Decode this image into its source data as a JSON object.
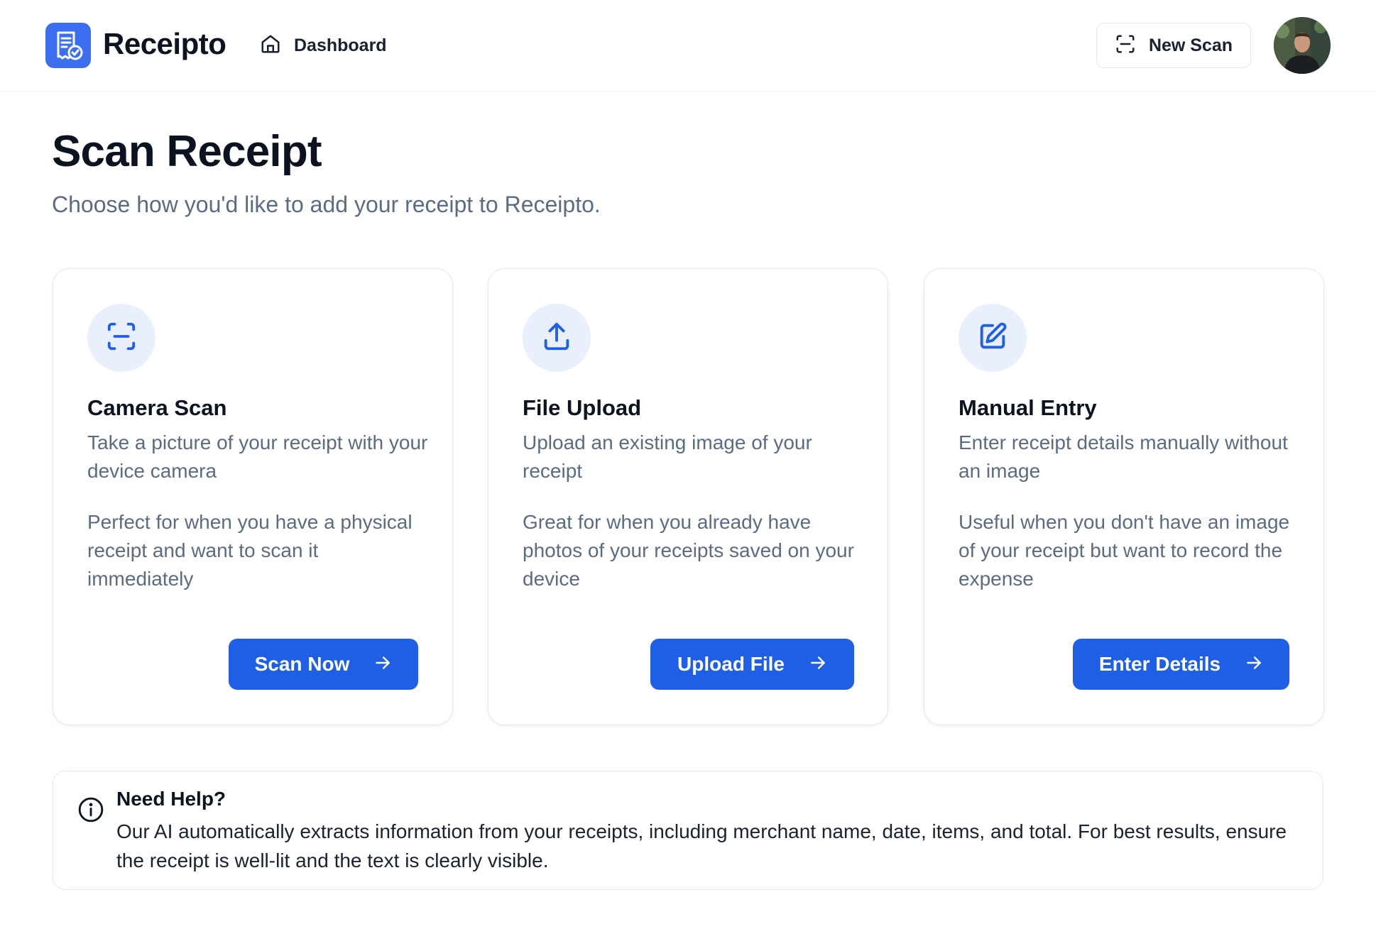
{
  "app": {
    "name": "Receipto"
  },
  "header": {
    "nav": [
      {
        "label": "Dashboard",
        "icon": "home-icon"
      }
    ],
    "new_scan_label": "New Scan",
    "new_scan_icon": "scan-frame-icon",
    "avatar": "user-avatar"
  },
  "page": {
    "title": "Scan Receipt",
    "subtitle": "Choose how you'd like to add your receipt to Receipto."
  },
  "cards": [
    {
      "icon": "scan-frame-icon",
      "title": "Camera Scan",
      "description": "Take a picture of your receipt with your device camera",
      "detail": "Perfect for when you have a physical receipt and want to scan it immediately",
      "action_label": "Scan Now"
    },
    {
      "icon": "upload-icon",
      "title": "File Upload",
      "description": "Upload an existing image of your receipt",
      "detail": "Great for when you already have photos of your receipts saved on your device",
      "action_label": "Upload File"
    },
    {
      "icon": "edit-icon",
      "title": "Manual Entry",
      "description": "Enter receipt details manually without an image",
      "detail": "Useful when you don't have an image of your receipt but want to record the expense",
      "action_label": "Enter Details"
    }
  ],
  "help": {
    "icon": "info-icon",
    "title": "Need Help?",
    "text": "Our AI automatically extracts information from your receipts, including merchant name, date, items, and total. For best results, ensure the receipt is well-lit and the text is clearly visible."
  },
  "colors": {
    "accent": "#1f5fe6",
    "logo_bg": "#3b6ff0",
    "icon_circle_bg": "#e9effc",
    "muted_text": "#5b6b82"
  }
}
